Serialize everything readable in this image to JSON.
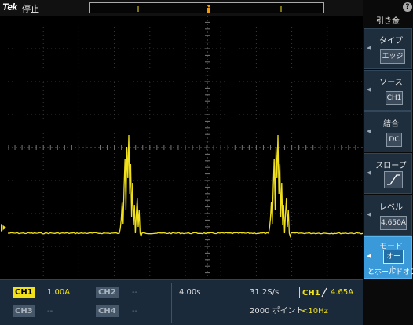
{
  "header": {
    "logo": "Tek",
    "run_status": "停止"
  },
  "side_menu": {
    "title": "引き金",
    "items": [
      {
        "label": "タイプ",
        "value": "エッジ"
      },
      {
        "label": "ソース",
        "value": "CH1"
      },
      {
        "label": "結合",
        "value": "DC"
      },
      {
        "label": "スロープ",
        "value": "rising-edge-icon"
      },
      {
        "label": "レベル",
        "value": "4.650A"
      },
      {
        "label": "モード",
        "value": "オート",
        "sub": "とホールドオフ"
      }
    ]
  },
  "readouts": {
    "ch1": {
      "label": "CH1",
      "scale": "1.00A"
    },
    "ch2": {
      "label": "CH2",
      "scale": "--"
    },
    "ch3": {
      "label": "CH3",
      "scale": "--"
    },
    "ch4": {
      "label": "CH4",
      "scale": "--"
    },
    "timebase": "4.00s",
    "sample_rate": "31.2S/s",
    "record_length": "2000 ポイント",
    "trigger": {
      "source": "CH1",
      "level": "4.65A",
      "frequency": "<10Hz"
    }
  },
  "colors": {
    "trace": "#f1e11a",
    "menu_bg": "#1f2e3d",
    "active": "#3a9ad9",
    "readout_bg": "#1b2a3a"
  }
}
